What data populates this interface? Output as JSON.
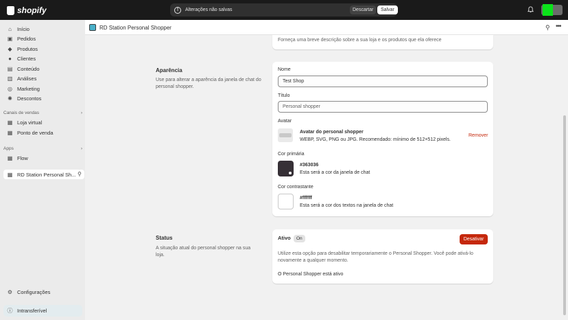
{
  "topbar": {
    "brand": "shopify",
    "unsaved_message": "Alterações não salvas",
    "discard_label": "Descartar",
    "save_label": "Salvar"
  },
  "sidebar": {
    "items": [
      {
        "label": "Início",
        "icon": "home-icon"
      },
      {
        "label": "Pedidos",
        "icon": "inbox-icon"
      },
      {
        "label": "Produtos",
        "icon": "tag-icon"
      },
      {
        "label": "Clientes",
        "icon": "person-icon"
      },
      {
        "label": "Conteúdo",
        "icon": "content-icon"
      },
      {
        "label": "Análises",
        "icon": "chart-icon"
      },
      {
        "label": "Marketing",
        "icon": "target-icon"
      },
      {
        "label": "Descontos",
        "icon": "discount-icon"
      }
    ],
    "sales_channels_heading": "Canais de vendas",
    "sales_channels": [
      {
        "label": "Loja virtual",
        "icon": "store-icon"
      },
      {
        "label": "Ponto de venda",
        "icon": "pos-icon"
      }
    ],
    "apps_heading": "Apps",
    "apps": [
      {
        "label": "Flow",
        "icon": "flow-icon"
      },
      {
        "label": "RD Station Personal Sh...",
        "icon": "app-icon"
      }
    ],
    "settings_label": "Configurações",
    "bottom_label": "Intransferível"
  },
  "header": {
    "app_title": "RD Station Personal Shopper"
  },
  "top_card": {
    "text": "Forneça uma breve descrição sobre a sua loja e os produtos que ela oferece"
  },
  "appearance": {
    "title": "Aparência",
    "description": "Use para alterar a aparência da janela de chat do personal shopper.",
    "name_label": "Nome",
    "name_value": "Test Shop",
    "title_label": "Título",
    "title_placeholder": "Personal shopper",
    "avatar_label": "Avatar",
    "avatar_title": "Avatar do personal shopper",
    "avatar_desc": "WEBP, SVG, PNG ou JPG. Recomendado: mínimo de 512×512 pixels.",
    "remove_label": "Remover",
    "primary_label": "Cor primária",
    "primary_value": "#363036",
    "primary_desc": "Esta será a cor da janela de chat",
    "contrast_label": "Cor contrastante",
    "contrast_value": "#ffffff",
    "contrast_desc": "Esta será a cor dos textos na janela de chat"
  },
  "status": {
    "title": "Status",
    "description": "A situação atual do personal shopper na sua loja.",
    "active_label": "Ativo",
    "badge": "On",
    "deactivate_label": "Desativar",
    "info": "Utilize esta opção para desabilitar temporariamente o Personal Shopper. Você pode ativá-lo novamente a qualquer momento.",
    "state_text": "O Personal Shopper está ativo"
  },
  "colors": {
    "primary": "#363036",
    "contrast": "#ffffff",
    "danger": "#c5280c"
  }
}
